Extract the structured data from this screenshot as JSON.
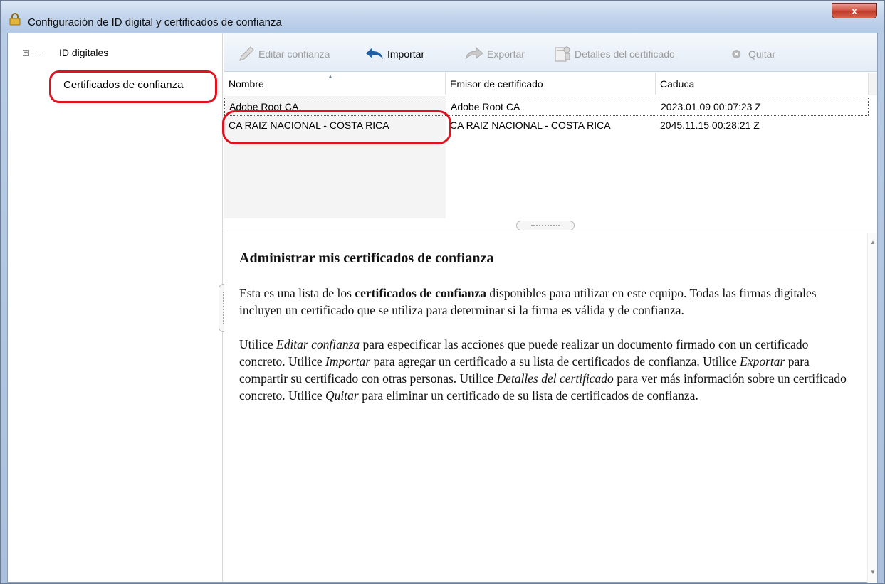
{
  "window": {
    "title": "Configuración de ID digital y certificados de confianza",
    "close_label": "x"
  },
  "tree": {
    "expander": "+",
    "items": [
      {
        "label": "ID digitales"
      },
      {
        "label": "Certificados de confianza"
      }
    ]
  },
  "toolbar": {
    "edit_trust": "Editar confianza",
    "import": "Importar",
    "export": "Exportar",
    "cert_details": "Detalles del certificado",
    "remove": "Quitar"
  },
  "table": {
    "columns": [
      "Nombre",
      "Emisor de certificado",
      "Caduca"
    ],
    "sort_indicator": "▲",
    "rows": [
      {
        "name": "Adobe Root CA",
        "issuer": "Adobe Root CA",
        "expires": "2023.01.09 00:07:23 Z"
      },
      {
        "name": "CA RAIZ NACIONAL - COSTA RICA",
        "issuer": "CA RAIZ NACIONAL - COSTA RICA",
        "expires": "2045.11.15 00:28:21 Z"
      }
    ]
  },
  "description": {
    "title": "Administrar mis certificados de confianza",
    "p1_a": "Esta es una lista de los ",
    "p1_b": "certificados de confianza",
    "p1_c": " disponibles para utilizar en este equipo. Todas las firmas digitales incluyen un certificado que se utiliza para determinar si la firma es válida y de confianza.",
    "p2_a": "Utilice ",
    "p2_b": "Editar confianza",
    "p2_c": " para especificar las acciones que puede realizar un documento firmado con un certificado concreto. Utilice ",
    "p2_d": "Importar",
    "p2_e": " para agregar un certificado a su lista de certificados de confianza. Utilice ",
    "p2_f": "Exportar",
    "p2_g": " para compartir su certificado con otras personas. Utilice ",
    "p2_h": "Detalles del certificado",
    "p2_i": " para ver más información sobre un certificado concreto. Utilice ",
    "p2_j": "Quitar",
    "p2_k": " para eliminar un certificado de su lista de certificados de confianza."
  },
  "colors": {
    "highlight_ring": "#e0121e",
    "import_icon": "#1e5fa8",
    "disabled_text": "#9c9c9c"
  }
}
